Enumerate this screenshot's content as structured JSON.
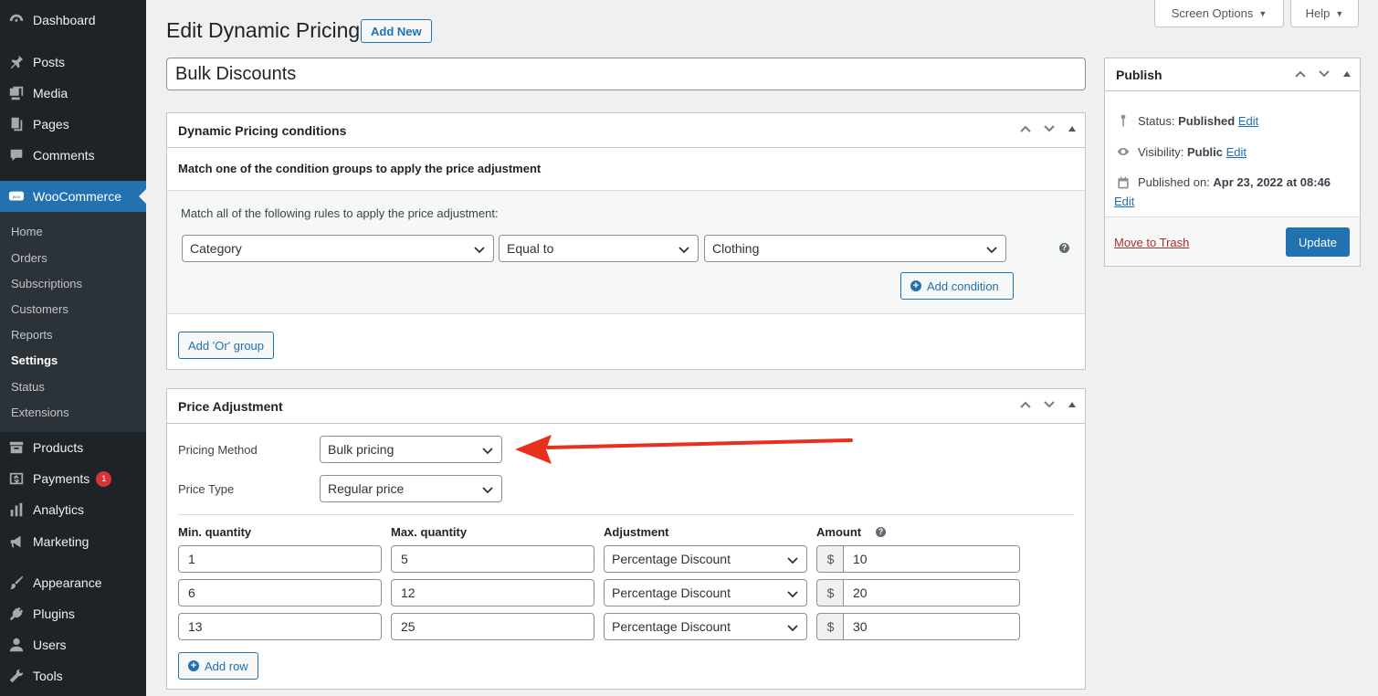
{
  "sidebar": {
    "top_items": [
      {
        "label": "Dashboard",
        "icon": "dashboard-icon"
      },
      {
        "label": "Posts",
        "icon": "pin-icon"
      },
      {
        "label": "Media",
        "icon": "media-icon"
      },
      {
        "label": "Pages",
        "icon": "pages-icon"
      },
      {
        "label": "Comments",
        "icon": "comments-icon"
      }
    ],
    "woocommerce": {
      "label": "WooCommerce",
      "icon": "woo-icon"
    },
    "woo_subitems": [
      "Home",
      "Orders",
      "Subscriptions",
      "Customers",
      "Reports",
      "Settings",
      "Status",
      "Extensions"
    ],
    "active_subitem": "Settings",
    "bottom_items": [
      {
        "label": "Products",
        "icon": "archive-icon"
      },
      {
        "label": "Payments",
        "icon": "dollar-icon",
        "badge": "1"
      },
      {
        "label": "Analytics",
        "icon": "bar-chart-icon"
      },
      {
        "label": "Marketing",
        "icon": "megaphone-icon"
      },
      {
        "label": "Appearance",
        "icon": "brush-icon"
      },
      {
        "label": "Plugins",
        "icon": "plug-icon"
      },
      {
        "label": "Users",
        "icon": "user-icon"
      },
      {
        "label": "Tools",
        "icon": "wrench-icon"
      }
    ]
  },
  "topbar": {
    "screen_options": "Screen Options",
    "help": "Help"
  },
  "header": {
    "title": "Edit Dynamic Pricing",
    "add_new": "Add New"
  },
  "post_title": "Bulk Discounts",
  "conditions": {
    "title": "Dynamic Pricing conditions",
    "intro": "Match one of the condition groups to apply the price adjustment",
    "group_intro": "Match all of the following rules to apply the price adjustment:",
    "rule": {
      "field": "Category",
      "operator": "Equal to",
      "value": "Clothing"
    },
    "add_condition": "Add condition",
    "add_or_group": "Add 'Or' group"
  },
  "price_adjustment": {
    "title": "Price Adjustment",
    "pricing_method_label": "Pricing Method",
    "pricing_method": "Bulk pricing",
    "price_type_label": "Price Type",
    "price_type": "Regular price",
    "columns": {
      "min": "Min. quantity",
      "max": "Max. quantity",
      "adjustment": "Adjustment",
      "amount": "Amount"
    },
    "currency": "$",
    "rows": [
      {
        "min": "1",
        "max": "5",
        "adjustment": "Percentage Discount",
        "amount": "10"
      },
      {
        "min": "6",
        "max": "12",
        "adjustment": "Percentage Discount",
        "amount": "20"
      },
      {
        "min": "13",
        "max": "25",
        "adjustment": "Percentage Discount",
        "amount": "30"
      }
    ],
    "add_row": "Add row"
  },
  "publish": {
    "title": "Publish",
    "status_label": "Status:",
    "status_value": "Published",
    "visibility_label": "Visibility:",
    "visibility_value": "Public",
    "published_label": "Published on:",
    "published_value": "Apr 23, 2022 at 08:46",
    "edit": "Edit",
    "trash": "Move to Trash",
    "update": "Update"
  },
  "colors": {
    "accent": "#2271b1",
    "sidebar": "#1d2327",
    "arrow": "#e8301e",
    "trash": "#b32d2e"
  }
}
